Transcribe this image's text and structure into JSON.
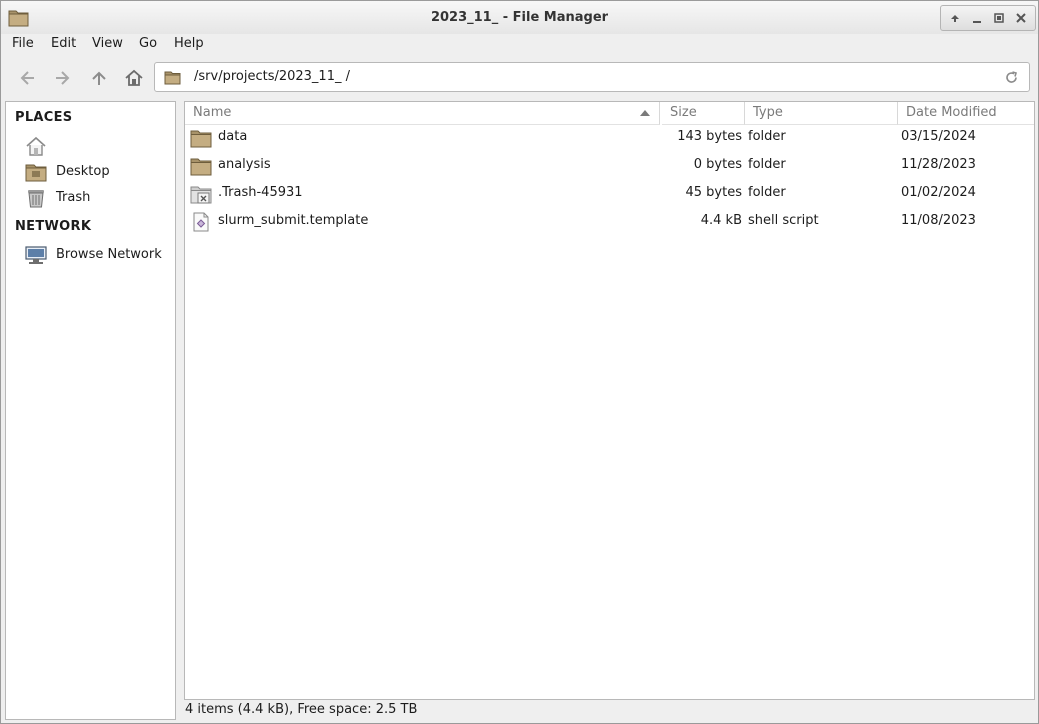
{
  "window": {
    "title": "2023_11_ - File Manager"
  },
  "menubar": {
    "items": [
      "File",
      "Edit",
      "View",
      "Go",
      "Help"
    ]
  },
  "toolbar": {
    "location": "/srv/projects/2023_11_ /"
  },
  "sidebar": {
    "places_header": "PLACES",
    "places": [
      {
        "label": "",
        "icon": "home-icon"
      },
      {
        "label": "Desktop",
        "icon": "desktop-icon"
      },
      {
        "label": "Trash",
        "icon": "trash-icon"
      }
    ],
    "network_header": "NETWORK",
    "network": [
      {
        "label": "Browse Network",
        "icon": "network-icon"
      }
    ]
  },
  "file_list": {
    "columns": [
      "Name",
      "Size",
      "Type",
      "Date Modified"
    ],
    "rows": [
      {
        "name": "data",
        "size": "143 bytes",
        "type": "folder",
        "date": "03/15/2024",
        "icon": "folder-icon"
      },
      {
        "name": "analysis",
        "size": "0 bytes",
        "type": "folder",
        "date": "11/28/2023",
        "icon": "folder-icon"
      },
      {
        "name": ".Trash-45931",
        "size": "45 bytes",
        "type": "folder",
        "date": "01/02/2024",
        "icon": "trash-folder-icon"
      },
      {
        "name": "slurm_submit.template",
        "size": "4.4 kB",
        "type": "shell script",
        "date": "11/08/2023",
        "icon": "script-file-icon"
      }
    ]
  },
  "statusbar": {
    "text": "4 items (4.4 kB), Free space: 2.5 TB"
  },
  "colors": {
    "folder": "#b09a6e",
    "folder_dark": "#8c7852",
    "border": "#b8b8b8",
    "header_text": "#7a7a7a"
  }
}
